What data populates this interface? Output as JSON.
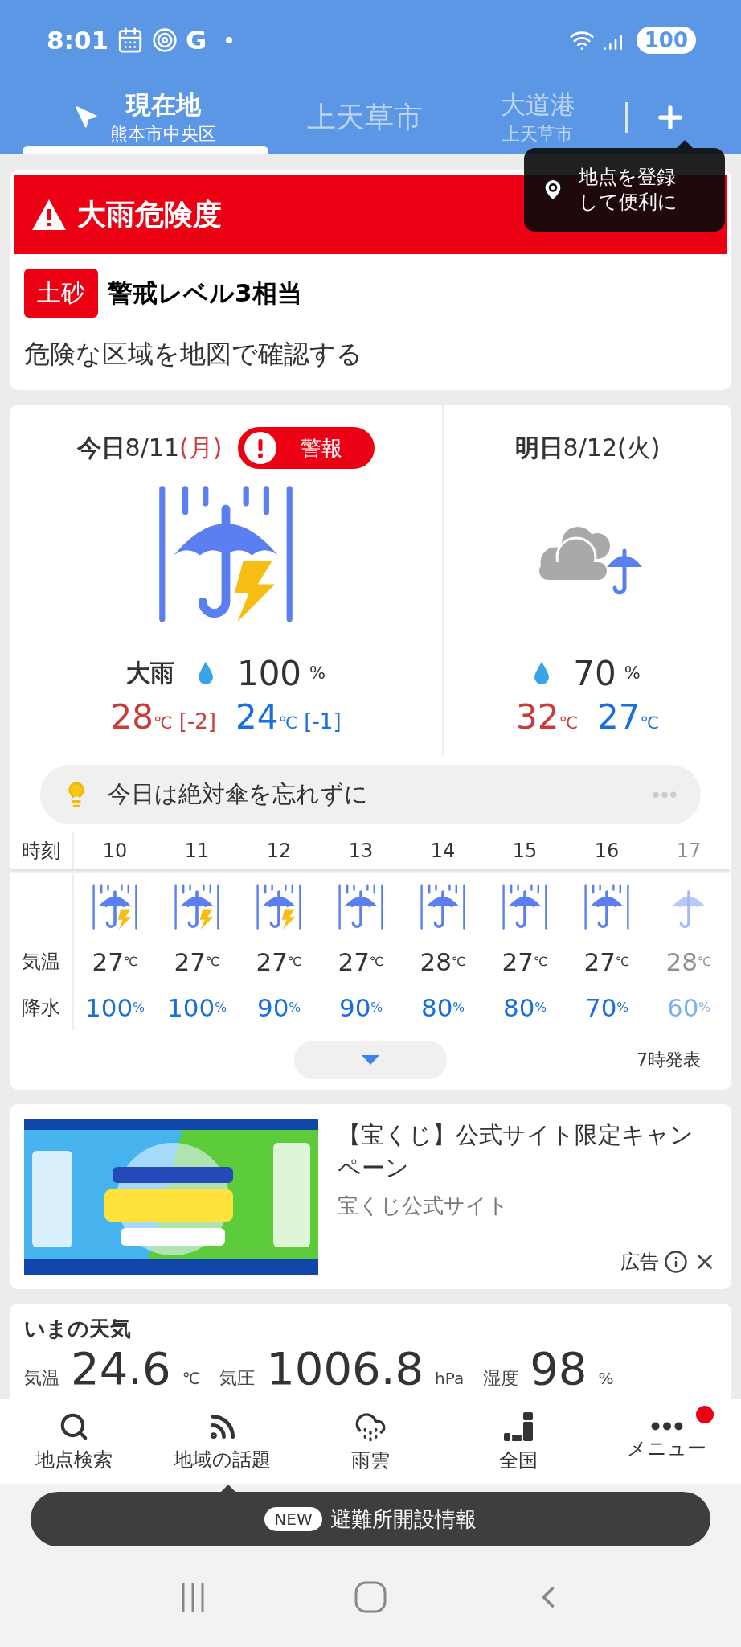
{
  "status_bar": {
    "time": "8:01",
    "letter": "G",
    "battery": "100"
  },
  "tabs": [
    {
      "kind": "current",
      "title": "現在地",
      "subtitle": "熊本市中央区",
      "selected": true
    },
    {
      "kind": "place",
      "title": "上天草市",
      "selected": false
    },
    {
      "kind": "place",
      "title": "大道港",
      "subtitle": "上天草市",
      "selected": false
    }
  ],
  "tooltip": {
    "text": "地点を登録して便利に"
  },
  "alert": {
    "title": "大雨危険度",
    "badge": "土砂",
    "level_text": "警戒レベル3相当",
    "link": "危険な区域を地図で確認する"
  },
  "forecast": {
    "days": [
      {
        "day": "今日",
        "date": "8/11",
        "weekday": "(月)",
        "holiday": true,
        "warning": "警報",
        "kind": "thunder_rain",
        "weather": "大雨",
        "precip": "100",
        "precip_unit": "%",
        "high": "28",
        "high_diff": "[-2]",
        "low": "24",
        "low_diff": "[-1]",
        "temp_unit": "℃"
      },
      {
        "day": "明日",
        "date": "8/12",
        "weekday": "(火)",
        "holiday": false,
        "kind": "cloud_rain",
        "precip": "70",
        "precip_unit": "%",
        "high": "32",
        "low": "27",
        "temp_unit": "℃"
      }
    ],
    "tip": "今日は絶対傘を忘れずに",
    "hourly": {
      "labels": [
        "時刻",
        "気温",
        "降水"
      ],
      "hours": [
        {
          "hour": "10",
          "kind": "thunder_rain",
          "temp": "27",
          "precip": "100",
          "faded": false
        },
        {
          "hour": "11",
          "kind": "thunder_rain",
          "temp": "27",
          "precip": "100",
          "faded": false
        },
        {
          "hour": "12",
          "kind": "thunder_rain",
          "temp": "27",
          "precip": "90",
          "faded": false
        },
        {
          "hour": "13",
          "kind": "heavy_rain",
          "temp": "27",
          "precip": "90",
          "faded": false
        },
        {
          "hour": "14",
          "kind": "heavy_rain",
          "temp": "28",
          "precip": "80",
          "faded": false
        },
        {
          "hour": "15",
          "kind": "heavy_rain",
          "temp": "27",
          "precip": "80",
          "faded": false
        },
        {
          "hour": "16",
          "kind": "heavy_rain",
          "temp": "27",
          "precip": "70",
          "faded": false
        },
        {
          "hour": "17",
          "kind": "rain",
          "temp": "28",
          "precip": "60",
          "faded": true
        }
      ],
      "temp_unit": "℃",
      "precip_unit": "%"
    },
    "issued": "7時発表"
  },
  "ad": {
    "title": "【宝くじ】公式サイト限定キャンペーン",
    "source": "宝くじ公式サイト",
    "label": "広告"
  },
  "current": {
    "title": "いまの天気",
    "items": [
      {
        "label": "気温",
        "value": "24.6",
        "unit": "℃"
      },
      {
        "label": "気圧",
        "value": "1006.8",
        "unit": "hPa"
      },
      {
        "label": "湿度",
        "value": "98",
        "unit": "%"
      }
    ]
  },
  "bottom_nav": [
    {
      "kind": "search",
      "label": "地点検索",
      "badge": false
    },
    {
      "kind": "feed",
      "label": "地域の話題",
      "badge": false
    },
    {
      "kind": "rain_cloud",
      "label": "雨雲",
      "badge": false
    },
    {
      "kind": "blocks",
      "label": "全国",
      "badge": false
    },
    {
      "kind": "more",
      "label": "メニュー",
      "badge": true
    }
  ],
  "banner": {
    "badge": "NEW",
    "text": "避難所開設情報"
  }
}
